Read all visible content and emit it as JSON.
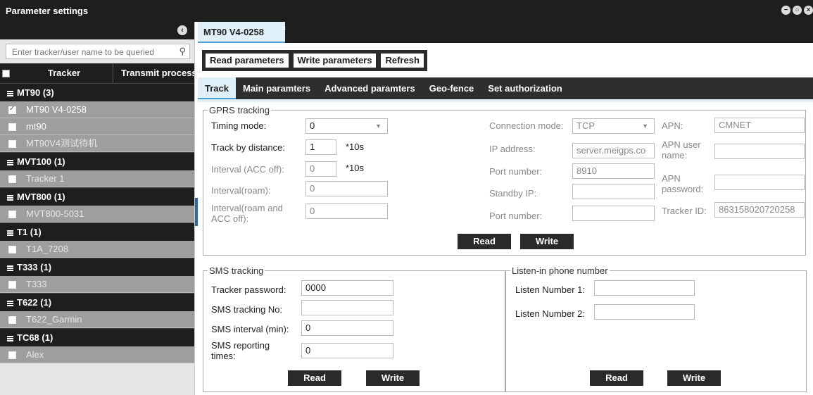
{
  "window": {
    "title": "Parameter settings"
  },
  "sidebar": {
    "search_placeholder": "Enter tracker/user name to be queried",
    "columns": {
      "tracker": "Tracker",
      "transmit": "Transmit process"
    },
    "groups": [
      {
        "label": "MT90 (3)",
        "items": [
          {
            "label": "MT90 V4-0258",
            "checked": true
          },
          {
            "label": "mt90",
            "checked": false
          },
          {
            "label": "MT90V4测试待机",
            "checked": false
          }
        ]
      },
      {
        "label": "MVT100 (1)",
        "items": [
          {
            "label": "Tracker 1",
            "checked": false
          }
        ]
      },
      {
        "label": "MVT800 (1)",
        "items": [
          {
            "label": "MVT800-5031",
            "checked": false
          }
        ]
      },
      {
        "label": "T1 (1)",
        "items": [
          {
            "label": "T1A_7208",
            "checked": false
          }
        ]
      },
      {
        "label": "T333 (1)",
        "items": [
          {
            "label": "T333",
            "checked": false
          }
        ]
      },
      {
        "label": "T622 (1)",
        "items": [
          {
            "label": "T622_Garmin",
            "checked": false
          }
        ]
      },
      {
        "label": "TC68 (1)",
        "items": [
          {
            "label": "Alex",
            "checked": false
          }
        ]
      }
    ]
  },
  "main": {
    "tab_label": "MT90 V4-0258",
    "tab_close": "×",
    "toolbar": {
      "read": "Read parameters",
      "write": "Write parameters",
      "refresh": "Refresh"
    },
    "subtabs": [
      "Track",
      "Main paramters",
      "Advanced paramters",
      "Geo-fence",
      "Set authorization"
    ],
    "gprs": {
      "legend": "GPRS tracking",
      "timing_mode_label": "Timing mode:",
      "timing_mode_value": "0",
      "track_distance_label": "Track by distance:",
      "track_distance_value": "1",
      "track_distance_unit": "*10s",
      "interval_acc_label": "Interval (ACC off):",
      "interval_acc_value": "0",
      "interval_acc_unit": "*10s",
      "interval_roam_label": "Interval(roam):",
      "interval_roam_value": "0",
      "interval_roam_acc_label": "Interval(roam and ACC off):",
      "interval_roam_acc_value": "0",
      "connection_mode_label": "Connection mode:",
      "connection_mode_value": "TCP",
      "ip_label": "IP address:",
      "ip_value": "server.meigps.co",
      "port_label": "Port number:",
      "port_value": "8910",
      "standby_ip_label": "Standby IP:",
      "standby_ip_value": "",
      "port2_label": "Port number:",
      "port2_value": "",
      "apn_label": "APN:",
      "apn_value": "CMNET",
      "apn_user_label": "APN user name:",
      "apn_user_value": "",
      "apn_pass_label": "APN password:",
      "apn_pass_value": "",
      "tracker_id_label": "Tracker ID:",
      "tracker_id_value": "863158020720258",
      "read": "Read",
      "write": "Write"
    },
    "sms": {
      "legend": "SMS tracking",
      "password_label": "Tracker password:",
      "password_value": "0000",
      "number_label": "SMS tracking No:",
      "number_value": "",
      "interval_label": "SMS interval (min):",
      "interval_value": "0",
      "times_label": "SMS reporting times:",
      "times_value": "0",
      "read": "Read",
      "write": "Write"
    },
    "listen": {
      "legend": "Listen-in phone number",
      "num1_label": "Listen Number 1:",
      "num1_value": "",
      "num2_label": "Listen Number 2:",
      "num2_value": "",
      "read": "Read",
      "write": "Write"
    }
  }
}
